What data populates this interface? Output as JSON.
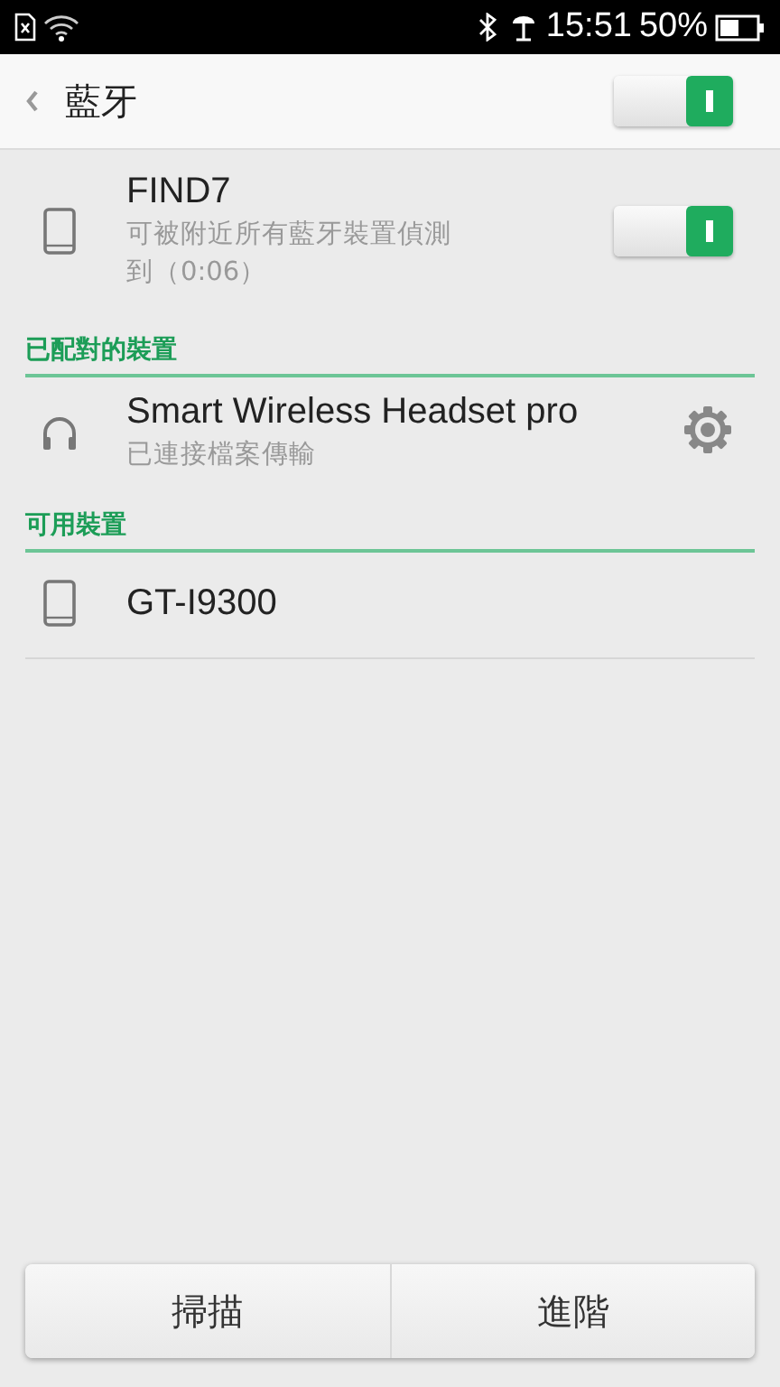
{
  "status_bar": {
    "time": "15:51",
    "battery": "50%"
  },
  "header": {
    "title": "藍牙",
    "bluetooth_on": true
  },
  "this_device": {
    "name": "FIND7",
    "status": "可被附近所有藍牙裝置偵測到（0:06）",
    "visible": true
  },
  "sections": [
    {
      "title": "已配對的裝置",
      "devices": [
        {
          "kind": "headset",
          "name": "Smart Wireless Headset pro",
          "status": "已連接檔案傳輸",
          "settings": true
        }
      ]
    },
    {
      "title": "可用裝置",
      "devices": [
        {
          "kind": "phone",
          "name": "GT-I9300"
        }
      ]
    }
  ],
  "buttons": [
    "掃描",
    "進階"
  ]
}
